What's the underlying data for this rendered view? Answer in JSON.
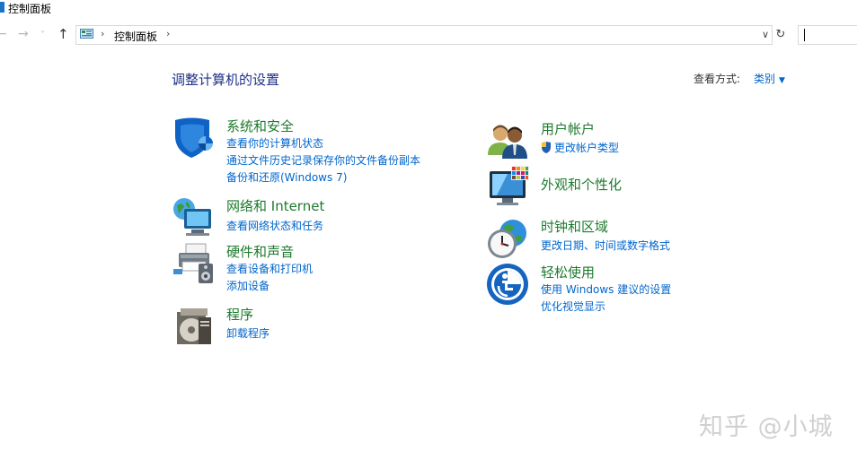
{
  "window": {
    "title": "控制面板"
  },
  "nav": {
    "back": "←",
    "forward": "→",
    "recent": "˅",
    "up": "↑",
    "refresh": "↻"
  },
  "address": {
    "sep1": "›",
    "path": "控制面板",
    "sep2": "›",
    "dropdown": "∨"
  },
  "search": {
    "value": ""
  },
  "page": {
    "title": "调整计算机的设置"
  },
  "view_by": {
    "label": "查看方式:",
    "value": "类别",
    "arrow": "▼"
  },
  "categories": {
    "system_security": {
      "title": "系统和安全",
      "links": [
        "查看你的计算机状态",
        "通过文件历史记录保存你的文件备份副本",
        "备份和还原(Windows 7)"
      ],
      "icon": "security-shield-icon"
    },
    "network": {
      "title": "网络和 Internet",
      "links": [
        "查看网络状态和任务"
      ],
      "icon": "network-globe-icon"
    },
    "hardware_sound": {
      "title": "硬件和声音",
      "links": [
        "查看设备和打印机",
        "添加设备"
      ],
      "icon": "printer-speaker-icon"
    },
    "programs": {
      "title": "程序",
      "links": [
        "卸载程序"
      ],
      "icon": "programs-disc-icon"
    },
    "user_accounts": {
      "title": "用户帐户",
      "links": [
        "更改帐户类型"
      ],
      "icon": "users-icon"
    },
    "appearance": {
      "title": "外观和个性化",
      "links": [],
      "icon": "monitor-palette-icon"
    },
    "clock_region": {
      "title": "时钟和区域",
      "links": [
        "更改日期、时间或数字格式"
      ],
      "icon": "clock-globe-icon"
    },
    "ease_of_access": {
      "title": "轻松使用",
      "links": [
        "使用 Windows 建议的设置",
        "优化视觉显示"
      ],
      "icon": "ease-of-access-icon"
    }
  },
  "watermark": "知乎 @小城"
}
